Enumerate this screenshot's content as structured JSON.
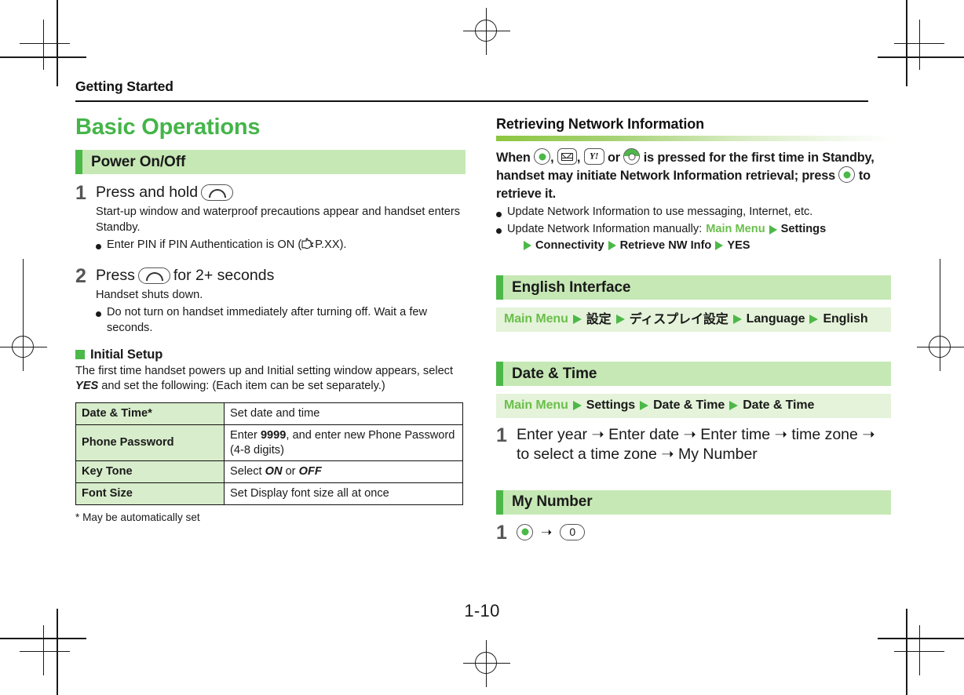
{
  "page": {
    "running_head": "Getting Started",
    "folio": "1-10",
    "accent_green": "#4cb848",
    "bar_green": "#c6e8b5",
    "crumb_green": "#e4f3d9",
    "title_green": "#44b549"
  },
  "left_column": {
    "chapter_title": "Basic Operations",
    "section_power": {
      "bar_title": "Power On/Off",
      "steps": [
        {
          "num": "1",
          "title_before": "Press and hold",
          "key_icon": "phone-end-key-icon",
          "title_after": "",
          "desc": "Start-up window and waterproof precautions appear and handset enters Standby.",
          "bullets": [
            {
              "before": "Enter PIN if PIN Authentication is ON (",
              "icon": "reference-hand-icon",
              "after": "P.XX)."
            }
          ]
        },
        {
          "num": "2",
          "title_before": "Press",
          "key_icon": "phone-end-key-icon",
          "title_after": "for 2+ seconds",
          "desc": "Handset shuts down.",
          "bullets": [
            {
              "before": "Do not turn on handset immediately after turning off. Wait a few seconds.",
              "icon": "",
              "after": ""
            }
          ]
        }
      ]
    },
    "initial_setup": {
      "heading": "Initial Setup",
      "intro": "The first time handset powers up and Initial setting window appears, select YES and set the following: (Each item can be set separately.)",
      "intro_emphasis": "YES",
      "table": {
        "rows": [
          {
            "key": "Date & Time*",
            "value": "Set date and time"
          },
          {
            "key": "Phone Password",
            "value": "Enter 9999, and enter new Phone Password (4-8 digits)"
          },
          {
            "key": "Key Tone",
            "value": "Select ON or OFF"
          },
          {
            "key": "Font Size",
            "value": "Set Display font size all at once"
          }
        ]
      },
      "footnote": "* May be automatically set"
    }
  },
  "right_column": {
    "section_network": {
      "heading": "Retrieving Network Information",
      "lead_parts": {
        "p1": "When",
        "p2": ",",
        "p3": ",",
        "p4": "or",
        "p5": "is pressed for the first time in Standby, handset may initiate Network Information retrieval; press",
        "p6": "to retrieve it."
      },
      "lead_keys": [
        "center-key-icon",
        "mail-key-icon",
        "yahoo-key-icon",
        "multi-function-key-icon",
        "center-key-icon"
      ],
      "bullets": [
        {
          "text": "Update Network Information to use messaging, Internet, etc."
        },
        {
          "text": "Update Network Information manually:",
          "crumb_first": "Main Menu",
          "crumb_rest": "Settings"
        }
      ],
      "bullet_continuation": [
        "Connectivity",
        "Retrieve NW Info",
        "YES"
      ]
    },
    "section_english": {
      "bar_title": "English Interface",
      "crumb": [
        "Main Menu",
        "設定",
        "ディスプレイ設定",
        "Language",
        "English"
      ]
    },
    "section_datetime": {
      "bar_title": "Date & Time",
      "crumb": [
        "Main Menu",
        "Settings",
        "Date & Time",
        "Date & Time"
      ],
      "steps": [
        {
          "num": "1",
          "text": "Enter year ➝ Enter date ➝ Enter time ➝ time zone ➝ to select a time zone ➝ My Number"
        }
      ]
    },
    "section_mynumber": {
      "bar_title": "My Number",
      "steps": [
        {
          "num": "1",
          "key_first": "center-key-icon",
          "arrow": "➝",
          "key_second": "0"
        }
      ]
    }
  }
}
